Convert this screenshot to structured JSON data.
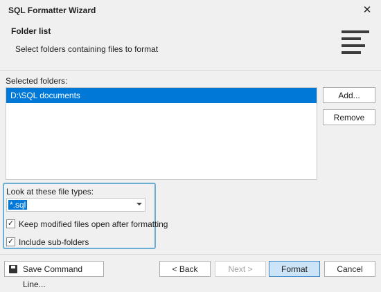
{
  "window": {
    "title": "SQL Formatter Wizard",
    "close_glyph": "✕"
  },
  "header": {
    "title": "Folder list",
    "subtitle": "Select folders containing files to format",
    "icon": "align-left-icon"
  },
  "folders": {
    "label": "Selected folders:",
    "items": [
      "D:\\SQL documents"
    ],
    "add_label": "Add...",
    "remove_label": "Remove"
  },
  "options": {
    "file_types_label": "Look at these file types:",
    "file_types_value": "*.sql",
    "keep_open_label": "Keep modified files open after formatting",
    "keep_open_checked": true,
    "subfolders_label": "Include sub-folders",
    "subfolders_checked": true,
    "check_glyph": "✓"
  },
  "footer": {
    "save_cmd_label": "Save Command Line...",
    "back_label": "< Back",
    "next_label": "Next >",
    "format_label": "Format",
    "cancel_label": "Cancel"
  },
  "colors": {
    "accent": "#0078d7",
    "group_border": "#6aaed6"
  }
}
